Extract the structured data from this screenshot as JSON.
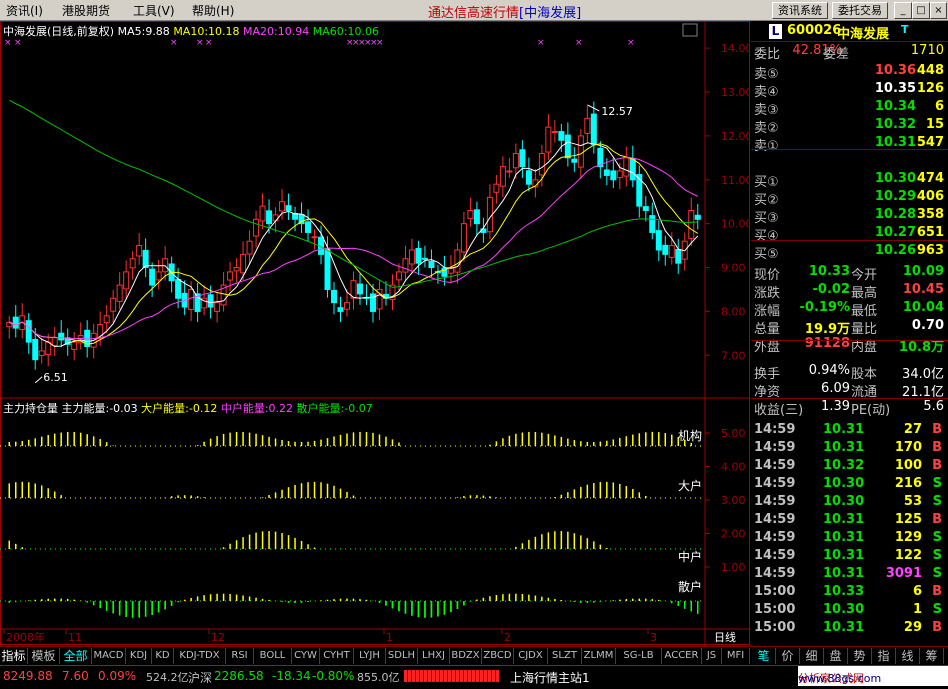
{
  "menu": {
    "items": [
      "资讯(I)",
      "港股期货",
      "工具(V)",
      "帮助(H)"
    ],
    "title": "通达信高速行情",
    "title_stock": "[中海发展]",
    "btn_info": "资讯系统",
    "btn_trade": "委托交易"
  },
  "chart": {
    "header": "中海发展(日线,前复权)",
    "ma5": "MA5:9.88",
    "ma10": "MA10:10.18",
    "ma20": "MA20:10.94",
    "ma60": "MA60:10.06",
    "high_label": "12.57",
    "low_label": "6.51",
    "yaxis": [
      "14.00",
      "13.00",
      "12.00",
      "11.00",
      "10.00",
      "9.00",
      "8.00",
      "7.00"
    ],
    "ind_header": "主力持仓量",
    "ind_v1": "主力能量:-0.03",
    "ind_v2": "大户能量:-0.12",
    "ind_v3": "中户能量:0.22",
    "ind_v4": "散户能量:-0.07",
    "ind_labels": [
      "机构",
      "大户",
      "中户",
      "散户"
    ],
    "ind_yaxis": [
      "5.00",
      "4.00",
      "3.00",
      "2.00",
      "1.00"
    ],
    "xaxis": [
      "2008年",
      "11",
      "12",
      "1",
      "2",
      "3"
    ],
    "period": "日线",
    "colors": {
      "up": "#ff3030",
      "down": "#00ffff",
      "ma5": "#ffffff",
      "ma10": "#ffff00",
      "ma20": "#ff40ff",
      "ma60": "#00c000"
    }
  },
  "chart_data": {
    "type": "candlestick",
    "ylim": [
      6.3,
      14.3
    ],
    "closes": [
      7.75,
      7.62,
      7.9,
      7.3,
      6.9,
      7.1,
      7.3,
      7.4,
      7.35,
      7.25,
      7.3,
      7.45,
      7.2,
      7.5,
      7.7,
      7.9,
      8.3,
      8.6,
      8.9,
      9.2,
      9.5,
      9.0,
      8.6,
      8.9,
      9.2,
      8.7,
      8.3,
      8.1,
      8.5,
      8.0,
      8.3,
      8.1,
      8.2,
      8.6,
      8.9,
      9.0,
      9.3,
      9.6,
      10.1,
      10.4,
      10.0,
      10.2,
      10.5,
      10.3,
      10.1,
      10.0,
      9.8,
      9.7,
      9.3,
      8.5,
      8.2,
      8.0,
      8.2,
      8.7,
      8.4,
      8.3,
      8.0,
      8.5,
      8.3,
      8.6,
      8.9,
      9.2,
      9.4,
      9.1,
      9.2,
      9.0,
      8.9,
      8.8,
      9.0,
      9.4,
      10.0,
      10.3,
      10.0,
      9.8,
      10.6,
      10.9,
      11.3,
      11.2,
      11.6,
      11.3,
      10.9,
      11.0,
      11.6,
      12.2,
      12.1,
      11.9,
      11.5,
      11.4,
      12.0,
      12.4,
      11.8,
      11.3,
      11.1,
      11.0,
      11.2,
      11.5,
      11.0,
      10.4,
      10.3,
      9.8,
      9.4,
      9.3,
      9.5,
      9.1,
      9.6,
      10.3,
      10.1
    ],
    "ma_last": {
      "MA5": 9.88,
      "MA10": 10.18,
      "MA20": 10.94,
      "MA60": 10.06
    }
  },
  "quote": {
    "code_badge": "L",
    "code": "600026",
    "name": "中海发展",
    "t_flag": "T",
    "weibi_label": "委比",
    "weibi": "42.81%",
    "weicha_label": "委差",
    "weicha": "1710",
    "asks": [
      {
        "label": "卖⑤",
        "price": "10.36",
        "vol": "448"
      },
      {
        "label": "卖④",
        "price": "10.35",
        "vol": "126"
      },
      {
        "label": "卖③",
        "price": "10.34",
        "vol": "6"
      },
      {
        "label": "卖②",
        "price": "10.32",
        "vol": "15"
      },
      {
        "label": "卖①",
        "price": "10.31",
        "vol": "547"
      }
    ],
    "bids": [
      {
        "label": "买①",
        "price": "10.30",
        "vol": "474"
      },
      {
        "label": "买②",
        "price": "10.29",
        "vol": "406"
      },
      {
        "label": "买③",
        "price": "10.28",
        "vol": "358"
      },
      {
        "label": "买④",
        "price": "10.27",
        "vol": "651"
      },
      {
        "label": "买⑤",
        "price": "10.26",
        "vol": "963"
      }
    ],
    "stats": [
      {
        "l1": "现价",
        "v1": "10.33",
        "l2": "今开",
        "v2": "10.09"
      },
      {
        "l1": "涨跌",
        "v1": "-0.02",
        "l2": "最高",
        "v2": "10.45"
      },
      {
        "l1": "涨幅",
        "v1": "-0.19%",
        "l2": "最低",
        "v2": "10.04"
      },
      {
        "l1": "总量",
        "v1": "19.9万",
        "l2": "量比",
        "v2": "0.70"
      },
      {
        "l1": "外盘",
        "v1": "91128",
        "l2": "内盘",
        "v2": "10.8万"
      }
    ],
    "fin": [
      {
        "l1": "换手",
        "v1": "0.94%",
        "l2": "股本",
        "v2": "34.0亿"
      },
      {
        "l1": "净资",
        "v1": "6.09",
        "l2": "流通",
        "v2": "21.1亿"
      },
      {
        "l1": "收益(三)",
        "v1": "1.39",
        "l2": "PE(动)",
        "v2": "5.6"
      }
    ],
    "ticks": [
      {
        "t": "14:59",
        "p": "10.31",
        "v": "27",
        "s": "B"
      },
      {
        "t": "14:59",
        "p": "10.31",
        "v": "170",
        "s": "B"
      },
      {
        "t": "14:59",
        "p": "10.32",
        "v": "100",
        "s": "B"
      },
      {
        "t": "14:59",
        "p": "10.30",
        "v": "216",
        "s": "S"
      },
      {
        "t": "14:59",
        "p": "10.30",
        "v": "53",
        "s": "S"
      },
      {
        "t": "14:59",
        "p": "10.31",
        "v": "125",
        "s": "B"
      },
      {
        "t": "14:59",
        "p": "10.31",
        "v": "129",
        "s": "S"
      },
      {
        "t": "14:59",
        "p": "10.31",
        "v": "122",
        "s": "S"
      },
      {
        "t": "14:59",
        "p": "10.31",
        "v": "3091",
        "s": "S"
      },
      {
        "t": "15:00",
        "p": "10.33",
        "v": "6",
        "s": "B"
      },
      {
        "t": "15:00",
        "p": "10.30",
        "v": "1",
        "s": "S"
      },
      {
        "t": "15:00",
        "p": "10.31",
        "v": "29",
        "s": "B"
      }
    ]
  },
  "tabs": [
    "指标",
    "模板",
    "全部",
    "MACD",
    "KDJ",
    "KD",
    "KDJ-TDX",
    "RSI",
    "BOLL",
    "CYW",
    "CYHT",
    "LYJH",
    "SDLH",
    "LHXJ",
    "BDZX",
    "ZBCD",
    "CJDX",
    "SLZT",
    "ZLMM",
    "SG-LB",
    "ACCER",
    "JS",
    "MFI"
  ],
  "rtabs": [
    "笔",
    "价",
    "细",
    "盘",
    "势",
    "指",
    "线",
    "筹"
  ],
  "status": {
    "idx1": "8249.88",
    "chg1": "7.60",
    "pct1": "0.09%",
    "amt1": "524.2亿",
    "name2": "沪深",
    "idx2": "2286.58",
    "chg2": "-18.34",
    "pct2": "-0.80%",
    "amt2": "855.0亿",
    "server": "上海行情主站1",
    "watermark": "分析家公式网",
    "site": "www.88gs.com"
  }
}
